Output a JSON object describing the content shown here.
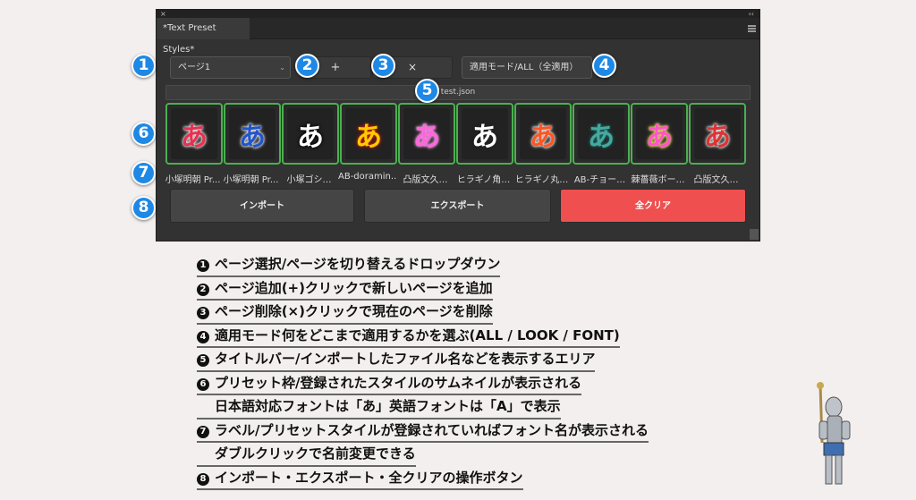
{
  "panel": {
    "close": "×",
    "collapse": "‹‹",
    "tab_title": "*Text Preset Styles*"
  },
  "controls": {
    "page_select": "ページ1",
    "add_page": "+",
    "delete_page": "×",
    "mode_select": "適用モード/ALL（全適用）",
    "filename": "test.json"
  },
  "presets": [
    {
      "glyph": "あ",
      "label": "小塚明朝 Pr...",
      "color": "#e83050",
      "glow": "#ffffff"
    },
    {
      "glyph": "あ",
      "label": "小塚明朝 Pr...",
      "color": "#2255cc",
      "glow": "#ffffff"
    },
    {
      "glyph": "あ",
      "label": "小塚ゴシ…",
      "color": "#ffffff",
      "glow": "#000000"
    },
    {
      "glyph": "あ",
      "label": "AB-doramin...",
      "color": "#ffcc00",
      "glow": "#d02000"
    },
    {
      "glyph": "あ",
      "label": "凸版文久…",
      "color": "#ff66dd",
      "glow": "#ffaaee"
    },
    {
      "glyph": "あ",
      "label": "ヒラギノ角…",
      "color": "#ffffff",
      "glow": "#222222"
    },
    {
      "glyph": "あ",
      "label": "ヒラギノ丸…",
      "color": "#ff5522",
      "glow": "#ffffff"
    },
    {
      "glyph": "あ",
      "label": "AB-チョー…",
      "color": "#44aaa0",
      "glow": "#226660"
    },
    {
      "glyph": "あ",
      "label": "棘薔薇ボー…",
      "color": "#ff55cc",
      "glow": "#ffee66"
    },
    {
      "glyph": "あ",
      "label": "凸版文久…",
      "color": "#dd3333",
      "glow": "#ffffff"
    }
  ],
  "actions": {
    "import": "インポート",
    "export": "エクスポート",
    "clear": "全クリア"
  },
  "callouts": [
    "1",
    "2",
    "3",
    "4",
    "5",
    "6",
    "7",
    "8"
  ],
  "notes": [
    {
      "n": "1",
      "text": "ページ選択/ページを切り替えるドロップダウン"
    },
    {
      "n": "2",
      "text": "ページ追加(+)クリックで新しいページを追加"
    },
    {
      "n": "3",
      "text": "ページ削除(×)クリックで現在のページを削除"
    },
    {
      "n": "4",
      "text": "適用モード何をどこまで適用するかを選ぶ(ALL / LOOK / FONT)"
    },
    {
      "n": "5",
      "text": "タイトルバー/インポートしたファイル名などを表示するエリア"
    },
    {
      "n": "6",
      "text": "プリセット枠/登録されたスタイルのサムネイルが表示される"
    },
    {
      "n": "",
      "text": "日本語対応フォントは「あ」英語フォントは「A」で表示"
    },
    {
      "n": "7",
      "text": "ラベル/プリセットスタイルが登録されていればフォント名が表示される"
    },
    {
      "n": "",
      "text": "ダブルクリックで名前変更できる"
    },
    {
      "n": "8",
      "text": "インポート・エクスポート・全クリアの操作ボタン"
    }
  ]
}
